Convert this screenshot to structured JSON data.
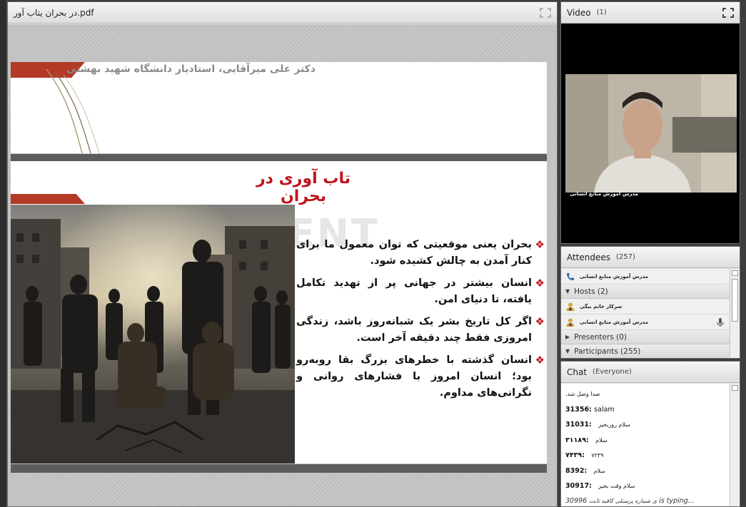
{
  "share": {
    "title": "در بحران یتاب آور.pdf",
    "slide1_author": "دکتر علی میرآقایی، استادیار دانشگاه شهید بهشتی",
    "slide2_title": "تاب آوری در بحران",
    "watermark": "AGEMENT",
    "bullets": [
      "بحران یعنی موقعیتی که توان معمول ما برای کنار آمدن به چالش کشیده شود.",
      "انسان بیشتر در جهانی پر از تهدید تکامل یافته، تا دنیای امن.",
      "اگر کل تاریخ بشر یک شبانه‌روز باشد، زندگی امروزی فقط چند دقیقه آخر است.",
      "انسان گذشته با خطرهای بزرگ بقا روبه‌رو بود؛ انسان امروز با فشارهای روانی و نگرانی‌های مداوم."
    ],
    "bullet_glyph": "❖"
  },
  "video": {
    "title": "Video",
    "count": "(1)",
    "presenter_label": "مدرس آموزش منابع انسانی"
  },
  "attendees": {
    "title": "Attendees",
    "count": "(257)",
    "current_speaker": "مدرس آموزش منابع انسانی",
    "groups": [
      {
        "label": "Hosts (2)",
        "expanded": true
      },
      {
        "label": "Presenters (0)",
        "expanded": false
      },
      {
        "label": "Participants (255)",
        "expanded": true
      }
    ],
    "hosts": [
      {
        "name": "سرکار خانم بیگی"
      },
      {
        "name": "مدرس آموزش منابع انسانی"
      }
    ]
  },
  "chat": {
    "title": "Chat",
    "scope": "(Everyone)",
    "messages": [
      {
        "sender": "",
        "text": "صدا وصل شد."
      },
      {
        "sender": "31356:",
        "text": "salam"
      },
      {
        "sender": "31031:",
        "text": "سلام روزبخیر"
      },
      {
        "sender": "۳۱۱۸۹:",
        "text": "سلام"
      },
      {
        "sender": "۷۴۳۹:",
        "text": "۷۲۳۹"
      },
      {
        "sender": "8392:",
        "text": "سلام"
      },
      {
        "sender": "30917:",
        "text": "سلام وقت بخیر"
      }
    ],
    "typing": "30996 is typing...",
    "typing_overlap": "ی شماره پرسنلی کافیه ثابت"
  },
  "colors": {
    "accent_red": "#c0141c",
    "band_red": "#b33a26"
  }
}
